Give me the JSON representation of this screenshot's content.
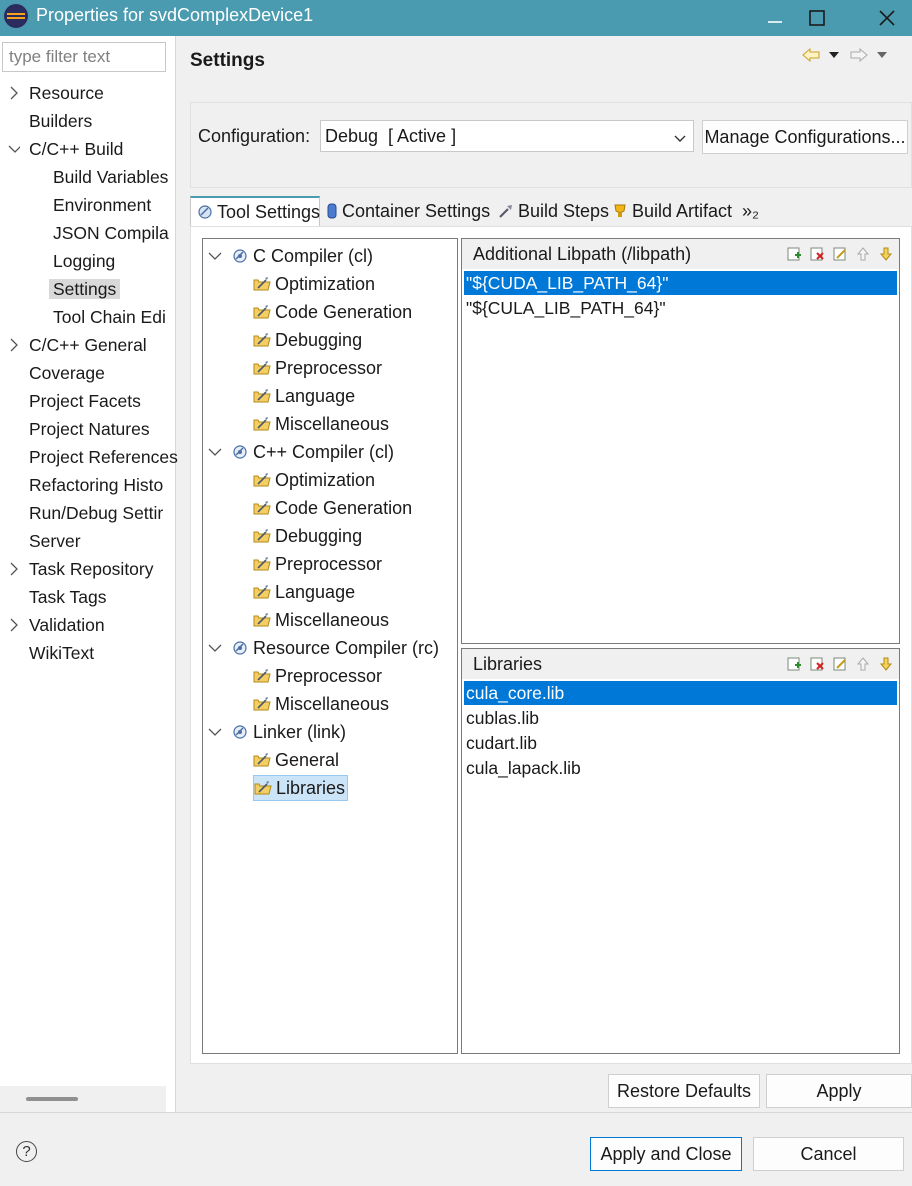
{
  "window": {
    "title": "Properties for svdComplexDevice1"
  },
  "filter": {
    "placeholder": "type filter text"
  },
  "nav": {
    "items": [
      {
        "label": "Resource",
        "expandable": true
      },
      {
        "label": "Builders"
      },
      {
        "label": "C/C++ Build",
        "expanded": true
      },
      {
        "label": "Build Variables"
      },
      {
        "label": "Environment"
      },
      {
        "label": "JSON Compila"
      },
      {
        "label": "Logging"
      },
      {
        "label": "Settings",
        "selected": true
      },
      {
        "label": "Tool Chain Edi"
      },
      {
        "label": "C/C++ General",
        "expandable": true
      },
      {
        "label": "Coverage"
      },
      {
        "label": "Project Facets"
      },
      {
        "label": "Project Natures"
      },
      {
        "label": "Project References"
      },
      {
        "label": "Refactoring Histo"
      },
      {
        "label": "Run/Debug Settir"
      },
      {
        "label": "Server"
      },
      {
        "label": "Task Repository",
        "expandable": true
      },
      {
        "label": "Task Tags"
      },
      {
        "label": "Validation",
        "expandable": true
      },
      {
        "label": "WikiText"
      }
    ]
  },
  "page": {
    "title": "Settings"
  },
  "config": {
    "label": "Configuration:",
    "value": "Debug  [ Active ]",
    "manage_label": "Manage Configurations..."
  },
  "tabs": [
    {
      "label": "Tool Settings",
      "icon": "tool-settings-icon",
      "active": true
    },
    {
      "label": "Container Settings",
      "icon": "container-icon"
    },
    {
      "label": "Build Steps",
      "icon": "build-steps-icon"
    },
    {
      "label": "Build Artifact",
      "icon": "artifact-icon"
    },
    {
      "label": "»₂",
      "icon": "more-tabs-icon"
    }
  ],
  "tool_tree": [
    {
      "label": "C Compiler (cl)",
      "children": [
        "Optimization",
        "Code Generation",
        "Debugging",
        "Preprocessor",
        "Language",
        "Miscellaneous"
      ]
    },
    {
      "label": "C++ Compiler (cl)",
      "children": [
        "Optimization",
        "Code Generation",
        "Debugging",
        "Preprocessor",
        "Language",
        "Miscellaneous"
      ]
    },
    {
      "label": "Resource Compiler (rc)",
      "children": [
        "Preprocessor",
        "Miscellaneous"
      ]
    },
    {
      "label": "Linker (link)",
      "children": [
        "General",
        "Libraries"
      ]
    }
  ],
  "libpath_list": {
    "title": "Additional Libpath (/libpath)",
    "items": [
      "\"${CUDA_LIB_PATH_64}\"",
      "\"${CULA_LIB_PATH_64}\""
    ],
    "selected_index": 0
  },
  "libraries_list": {
    "title": "Libraries",
    "items": [
      "cula_core.lib",
      "cublas.lib",
      "cudart.lib",
      "cula_lapack.lib"
    ],
    "selected_index": 0
  },
  "buttons": {
    "restore_defaults": "Restore Defaults",
    "apply": "Apply",
    "apply_and_close": "Apply and Close",
    "cancel": "Cancel",
    "help": "?"
  },
  "colors": {
    "titlebar": "#4b9bb0",
    "selection": "#0078d7",
    "tree_selection": "#cce4f7"
  }
}
